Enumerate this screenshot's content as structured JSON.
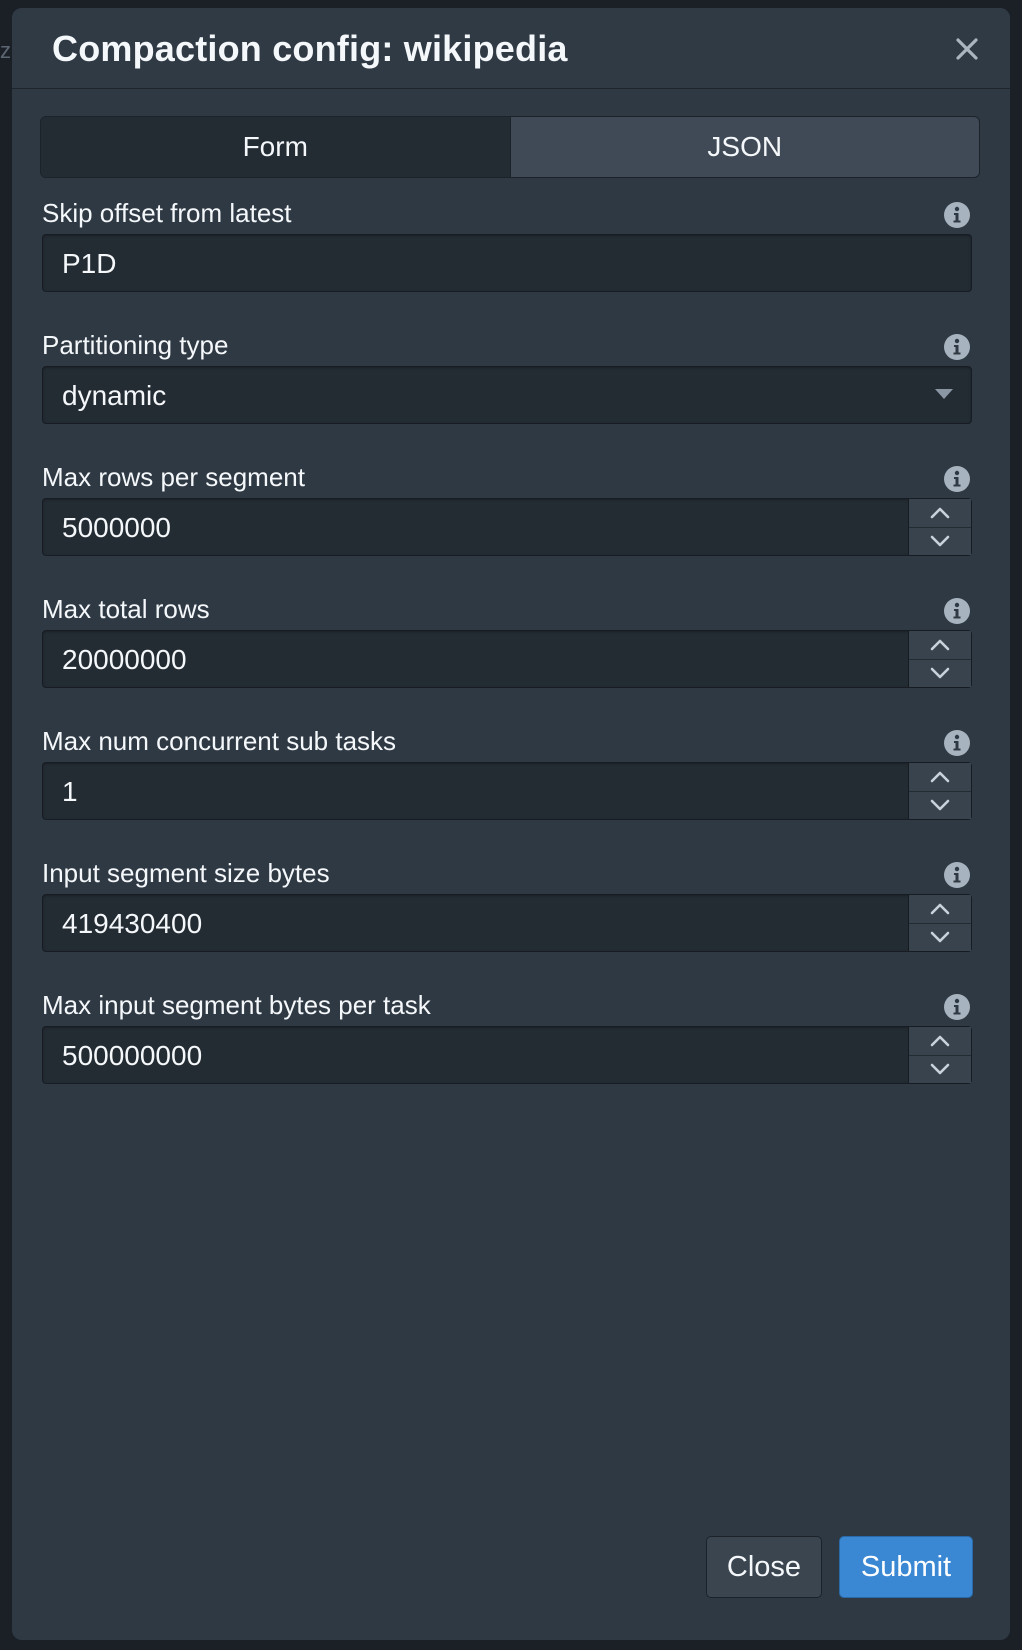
{
  "dialog": {
    "title": "Compaction config: wikipedia"
  },
  "tabs": [
    {
      "label": "Form",
      "active": false
    },
    {
      "label": "JSON",
      "active": true
    }
  ],
  "fields": {
    "skip_offset": {
      "label": "Skip offset from latest",
      "value": "P1D"
    },
    "partitioning_type": {
      "label": "Partitioning type",
      "value": "dynamic"
    },
    "max_rows_per_segment": {
      "label": "Max rows per segment",
      "value": "5000000"
    },
    "max_total_rows": {
      "label": "Max total rows",
      "value": "20000000"
    },
    "max_num_concurrent_sub_tasks": {
      "label": "Max num concurrent sub tasks",
      "value": "1"
    },
    "input_segment_size_bytes": {
      "label": "Input segment size bytes",
      "value": "419430400"
    },
    "max_input_segment_bytes_per_task": {
      "label": "Max input segment bytes per task",
      "value": "500000000"
    }
  },
  "footer": {
    "close_label": "Close",
    "submit_label": "Submit"
  },
  "colors": {
    "dialog_bg": "#2f3944",
    "input_bg": "#232b33",
    "primary": "#3a87d3",
    "text": "#f5f8fa"
  },
  "icons": [
    "close-icon",
    "info-icon",
    "chevron-up-icon",
    "chevron-down-icon",
    "caret-down-icon"
  ]
}
